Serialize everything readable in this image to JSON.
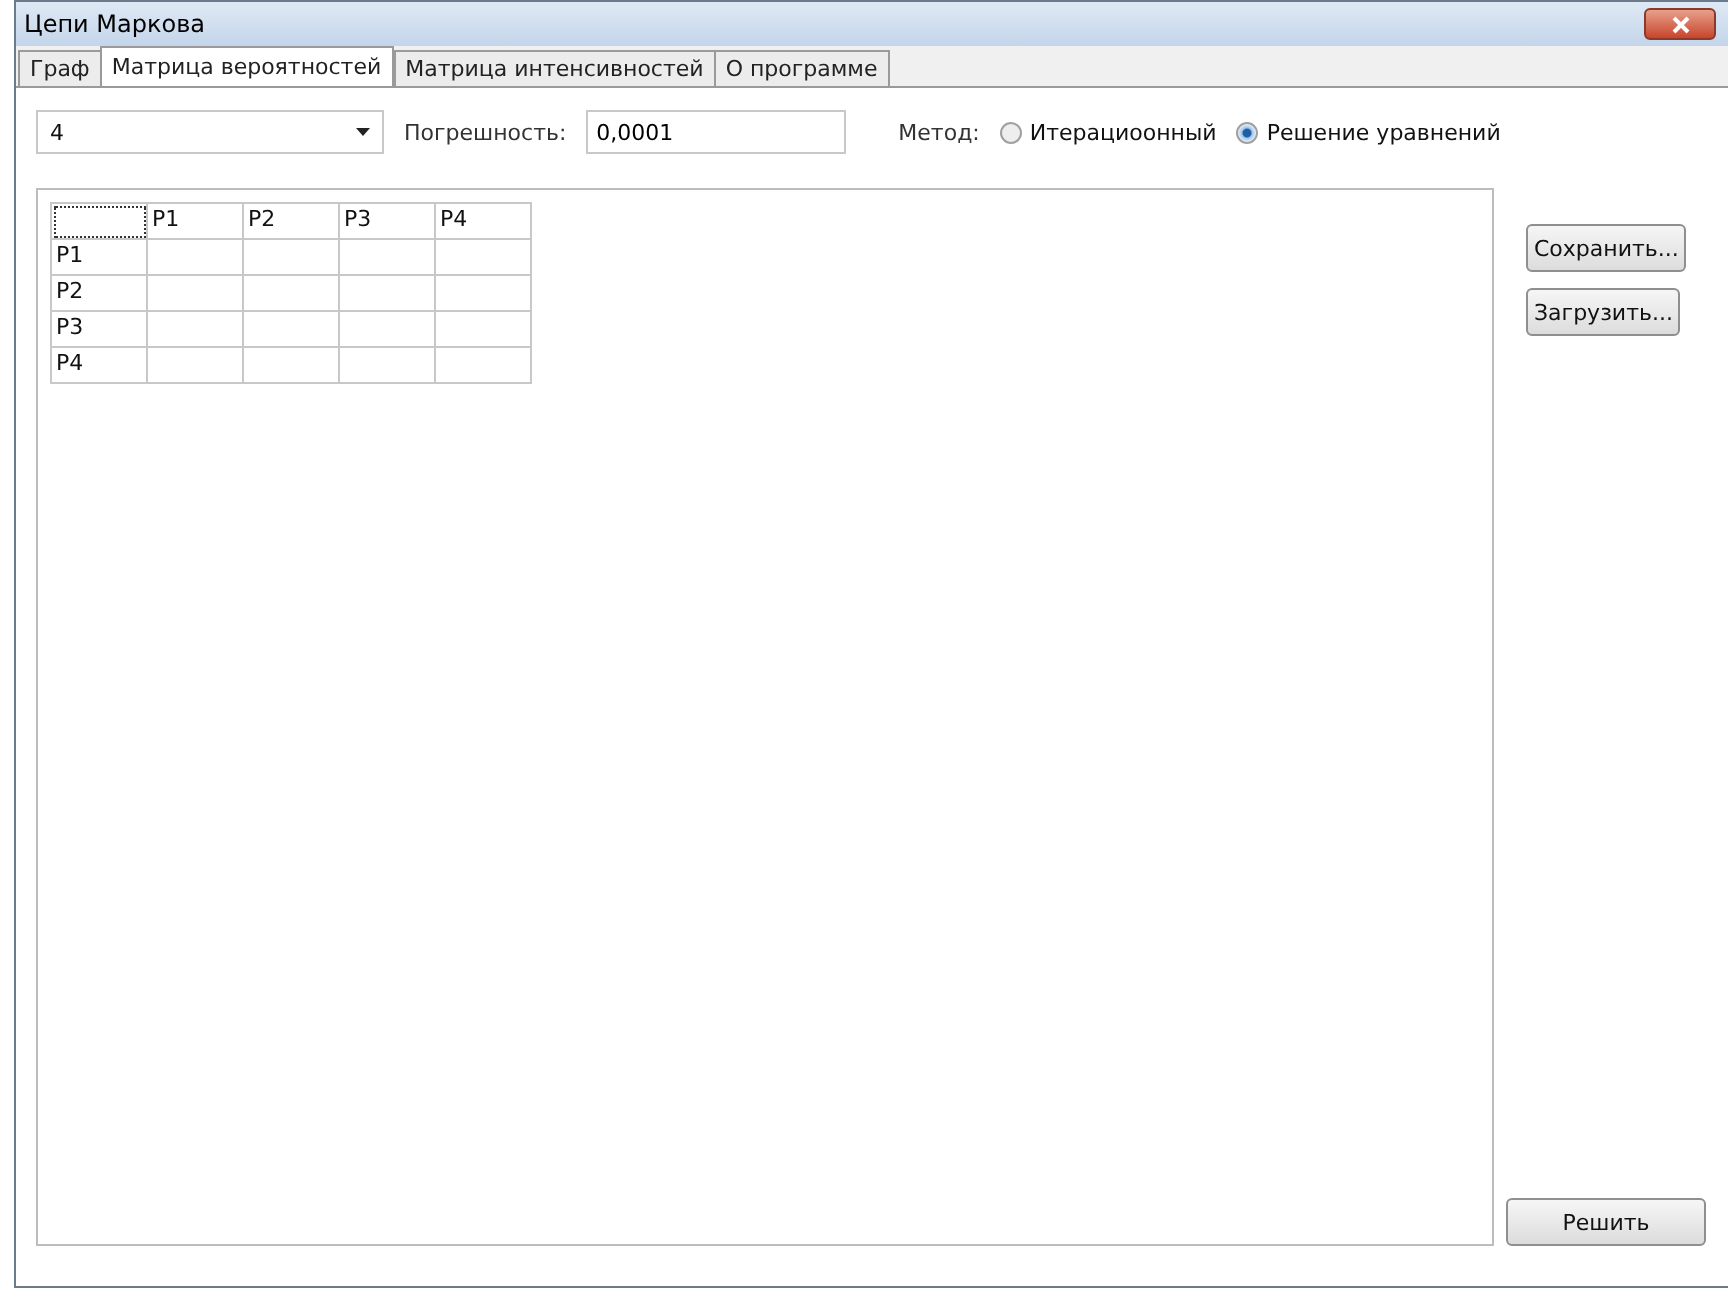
{
  "window": {
    "title": "Цепи Маркова"
  },
  "tabs": [
    {
      "label": "Граф",
      "selected": false
    },
    {
      "label": "Матрица вероятностей",
      "selected": true
    },
    {
      "label": "Матрица интенсивностей",
      "selected": false
    },
    {
      "label": "О программе",
      "selected": false
    }
  ],
  "size_select": {
    "value": "4"
  },
  "tolerance": {
    "label": "Погрешность:",
    "value": "0,0001"
  },
  "method": {
    "label": "Метод:",
    "options": [
      {
        "label": "Итерациоонный",
        "selected": false
      },
      {
        "label": "Решение уравнений",
        "selected": true
      }
    ]
  },
  "matrix": {
    "columns": [
      "P1",
      "P2",
      "P3",
      "P4"
    ],
    "rows": [
      "P1",
      "P2",
      "P3",
      "P4"
    ]
  },
  "side_buttons": [
    "Сохранить...",
    "Загрузить..."
  ],
  "solve_button": "Решить"
}
